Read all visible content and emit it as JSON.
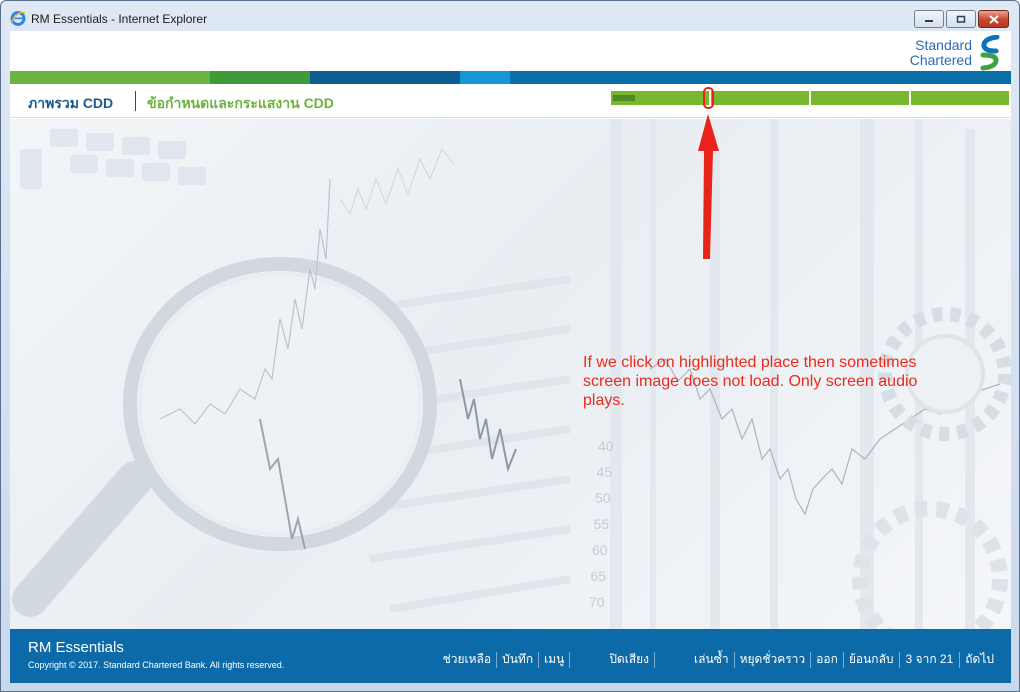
{
  "window": {
    "title": "RM Essentials - Internet Explorer",
    "icon": "internet-explorer-icon",
    "buttons": {
      "minimize": "minimize-icon",
      "maximize": "maximize-icon",
      "close": "close-icon"
    }
  },
  "brand": {
    "line1": "Standard",
    "line2": "Chartered",
    "mark": "standard-chartered-logo",
    "colors": {
      "blue": "#2a6db5",
      "green": "#6db33f",
      "footer": "#0d6aa8"
    }
  },
  "nav": {
    "title": "ภาพรวม CDD",
    "subtitle": "ข้อกำหนดและกระแสงาน CDD"
  },
  "progress": {
    "segments": 4,
    "current_segment": 1,
    "current_segment_fill": 0.25
  },
  "scene": {
    "axis_numbers": [
      "40",
      "45",
      "50",
      "55",
      "60",
      "65",
      "70"
    ]
  },
  "annotation": {
    "text": "If we click on highlighted place then sometimes screen image does not load. Only screen audio plays.",
    "color": "#ea2a1c"
  },
  "footer": {
    "app_name": "RM Essentials",
    "copyright": "Copyright © 2017. Standard Chartered Bank. All rights reserved.",
    "nav": {
      "help": "ช่วยเหลือ",
      "notes": "บันทึก",
      "menu": "เมนู",
      "mute": "ปิดเสียง",
      "replay": "เล่นซ้ำ",
      "pause": "หยุดชั่วคราว",
      "exit": "ออก",
      "back": "ย้อนกลับ",
      "page_status": "3 จาก 21",
      "next": "ถัดไป"
    }
  }
}
